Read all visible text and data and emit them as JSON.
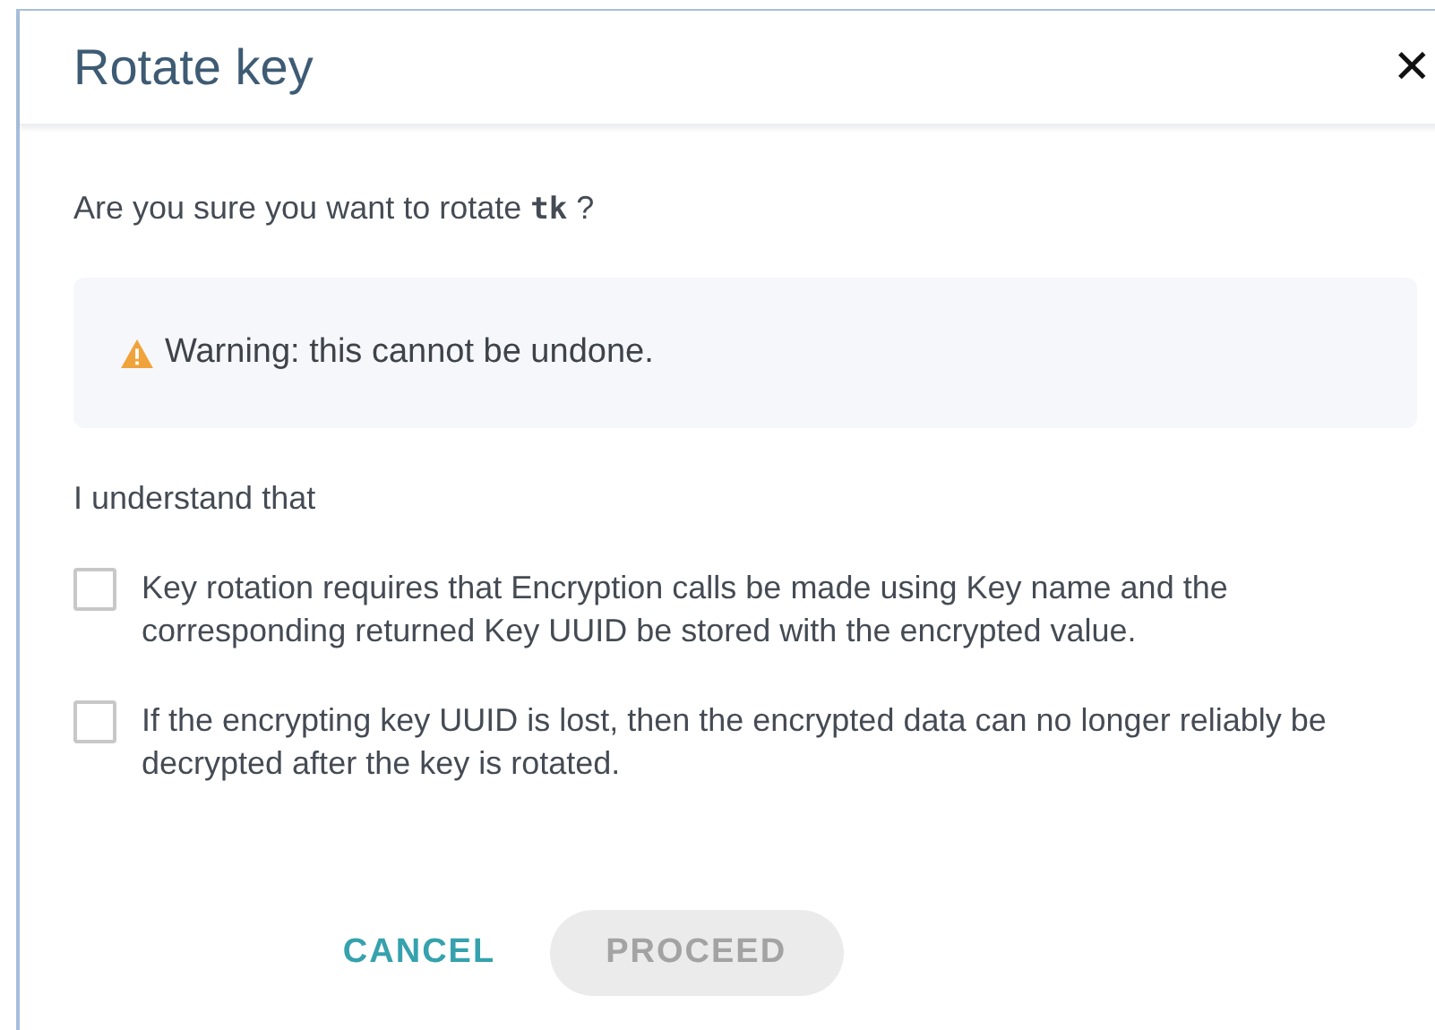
{
  "dialog": {
    "title": "Rotate key",
    "close": "✕"
  },
  "question": "Are you sure you want to rotate **tk** ?",
  "warning": {
    "text": "Warning: this cannot be undone."
  },
  "acknowledge_label": "I understand that",
  "checkboxes": [
    {
      "label": "Key rotation requires that Encryption calls be made using Key name and the corresponding returned Key UUID be stored with the encrypted value.",
      "checked": false
    },
    {
      "label": "If the encrypting key UUID is lost, then the encrypted data can no longer reliably be decrypted after the key is rotated.",
      "checked": false
    }
  ],
  "buttons": [
    {
      "label": "CANCEL",
      "kind": "text",
      "disabled": false
    },
    {
      "label": "PROCEED",
      "kind": "filled",
      "disabled": true
    }
  ]
}
